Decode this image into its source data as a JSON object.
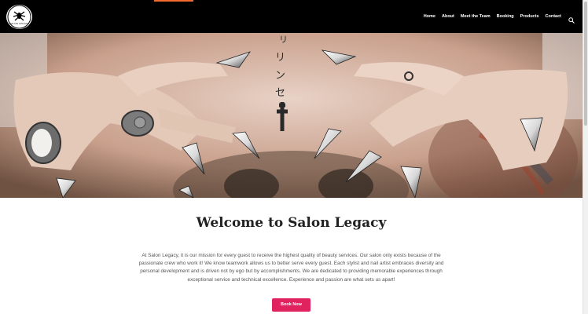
{
  "brand": {
    "logo_text": "SALON LEGACY",
    "accent_color": "#f26a2e"
  },
  "nav": {
    "items": [
      {
        "label": "Home"
      },
      {
        "label": "About"
      },
      {
        "label": "Meet the Team"
      },
      {
        "label": "Booking"
      },
      {
        "label": "Products"
      },
      {
        "label": "Contact"
      }
    ],
    "search_icon": "search-icon"
  },
  "hero": {
    "image": "tattooed back with hands and long pointed chrome nails"
  },
  "welcome": {
    "title": "Welcome to Salon Legacy",
    "mission": "At Salon Legacy, it is our mission for every guest to receive the highest quality of beauty services. Our salon only exists because of the passionate crew who work it! We know teamwork allows us to better serve every guest. Each stylist and nail artist embraces diversity and personal development and is driven not by ego but by accomplishments. We are dedicated to providing memorable experiences through exceptional service and technical excellence. Experience and passion are what sets us apart!",
    "book_button": "Book Now",
    "button_color": "#e0235e"
  }
}
